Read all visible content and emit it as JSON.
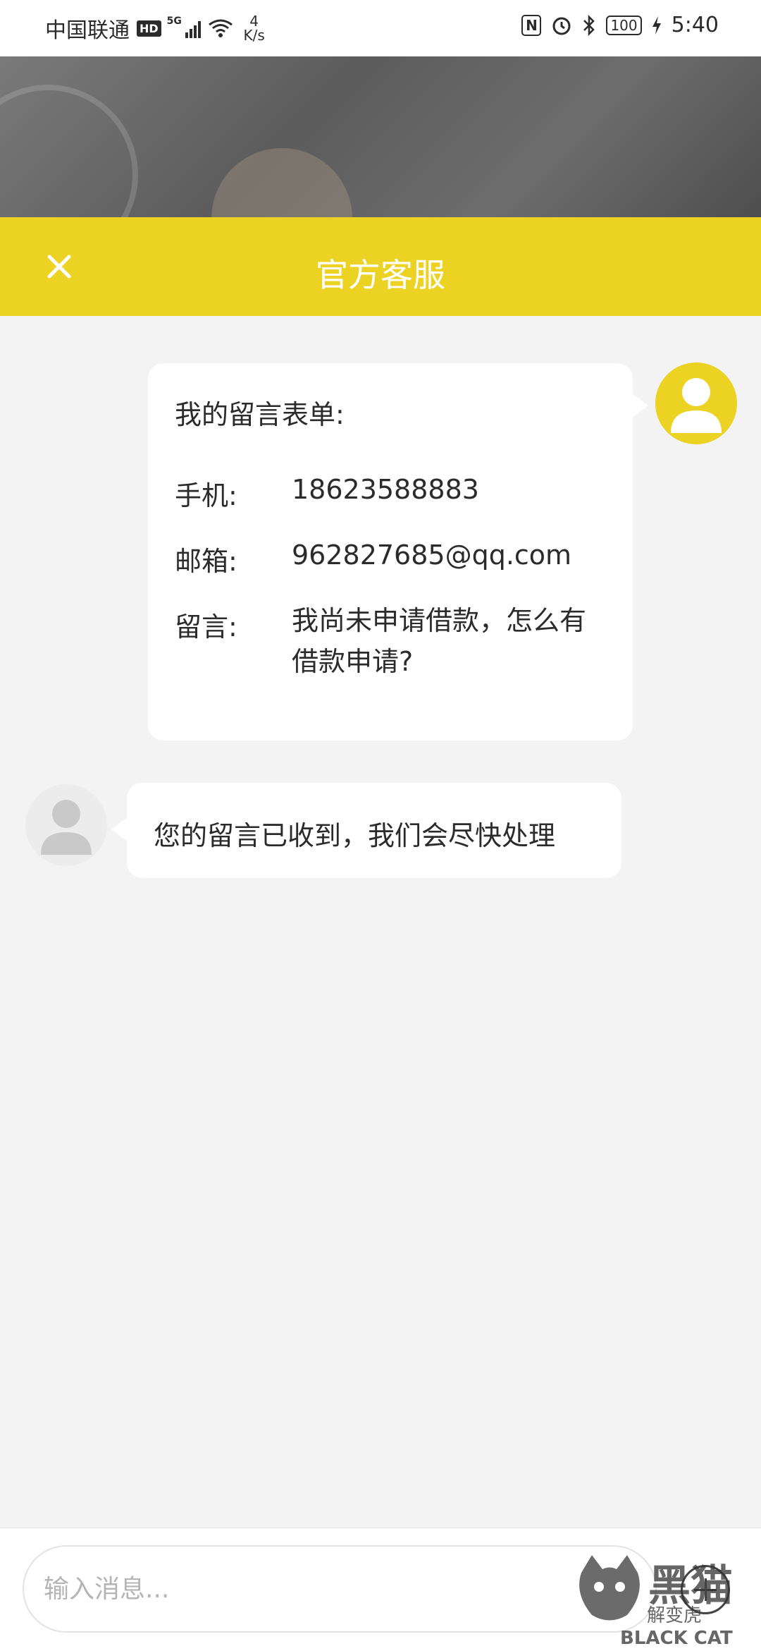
{
  "status_bar": {
    "carrier": "中国联通",
    "hd": "HD",
    "network": "5G",
    "speed_value": "4",
    "speed_unit": "K/s",
    "battery": "100",
    "time": "5:40"
  },
  "header": {
    "title": "官方客服",
    "accent_color": "#ecd223"
  },
  "messages": [
    {
      "sender": "user",
      "heading": "我的留言表单:",
      "fields": [
        {
          "label": "手机:",
          "value": "18623588883"
        },
        {
          "label": "邮箱:",
          "value": "962827685@qq.com"
        },
        {
          "label": "留言:",
          "value": "我尚未申请借款，怎么有借款申请?"
        }
      ]
    },
    {
      "sender": "agent",
      "text": "您的留言已收到，我们会尽快处理"
    }
  ],
  "input": {
    "placeholder": "输入消息..."
  },
  "watermark": {
    "brand": "黑猫",
    "sub": "解变虎",
    "latin": "BLACK CAT"
  }
}
